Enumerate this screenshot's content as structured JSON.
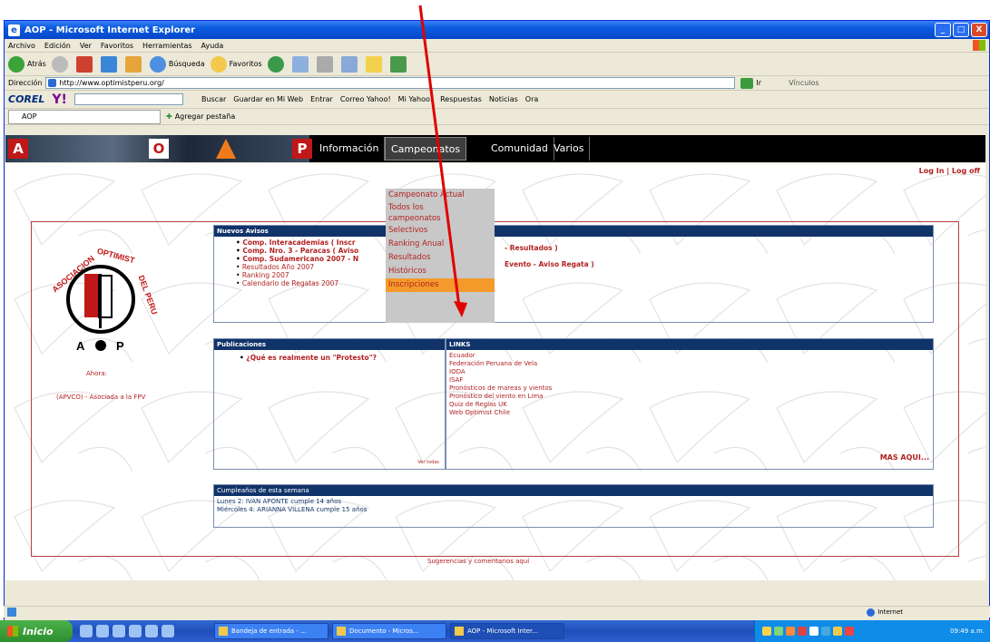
{
  "window": {
    "title": "AOP - Microsoft Internet Explorer",
    "controls": [
      "_",
      "□",
      "X"
    ]
  },
  "menu": [
    "Archivo",
    "Edición",
    "Ver",
    "Favoritos",
    "Herramientas",
    "Ayuda"
  ],
  "toolbar": {
    "back": "Atrás",
    "search": "Búsqueda",
    "favorites": "Favoritos"
  },
  "address": {
    "label": "Dirección",
    "url": "http://www.optimistperu.org/",
    "go": "Ir",
    "links": "Vínculos"
  },
  "corel_bar": {
    "brand": "COREL",
    "yahoo": "Y!",
    "items": [
      "Buscar",
      "Guardar en Mi Web",
      "Entrar",
      "Correo Yahoo!",
      "Mi Yahoo!",
      "Respuestas",
      "Noticias",
      "Ora"
    ]
  },
  "tabs": {
    "current": "AOP",
    "add": "Agregar pestaña"
  },
  "site": {
    "letters": [
      "A",
      "O",
      "P"
    ],
    "nav": [
      "Información",
      "Campeonatos",
      "Comunidad",
      "Varios"
    ],
    "login": "Log In | Log off",
    "dropdown": [
      "Campeonato Actual",
      "Todos los campeonatos",
      "Selectivos",
      "Ranking Anual",
      "Resultados",
      "Históricos",
      "Inscripciones"
    ],
    "avisos": {
      "title": "Nuevos Avisos",
      "items": [
        "Comp. Interacademias ( Inscr",
        "Comp. Nro. 3 - Paracas ( Aviso",
        "Comp. Sudamericano 2007 - N",
        "Resultados Año 2007",
        "Ranking 2007",
        "Calendario de Regatas 2007"
      ],
      "tail1": "- Resultados )",
      "tail2": "Evento - Aviso Regata )"
    },
    "publicaciones": {
      "title": "Publicaciones",
      "item": "¿Qué es realmente un \"Protesto\"?",
      "more": "Ver todas"
    },
    "links": {
      "title": "LINKS",
      "items": [
        "Ecuador",
        "Federación Peruana de Vela",
        "IODA",
        "ISAF",
        "Pronósticos de mareas y vientos",
        "Pronóstico del viento en Lima",
        "Quiz de Reglas UK",
        "Web Optimist Chile"
      ],
      "more": "MAS AQUI..."
    },
    "cumpleanos": {
      "title": "Cumpleaños de esta semana",
      "items": [
        "Lunes 2: IVAN APONTE cumple 14 años",
        "Miércoles 4: ARIANNA VILLENA cumple 15 años"
      ]
    },
    "logo": {
      "caption1": "Ahora:",
      "caption2": "(APVCO) - Asociada a la FPV"
    },
    "suggest": "Sugerencias y comentarios aquí"
  },
  "status": {
    "zone": "Internet"
  },
  "taskbar": {
    "start": "Inicio",
    "tasks": [
      "Bandeja de entrada - ...",
      "Documento - Micros...",
      "AOP - Microsoft Inter..."
    ],
    "clock": "09:49 a.m."
  },
  "colors": {
    "accent_red": "#b22222",
    "panel_blue": "#10336a",
    "dropdown_highlight": "#f39a2a",
    "annotation": "#e00000"
  }
}
